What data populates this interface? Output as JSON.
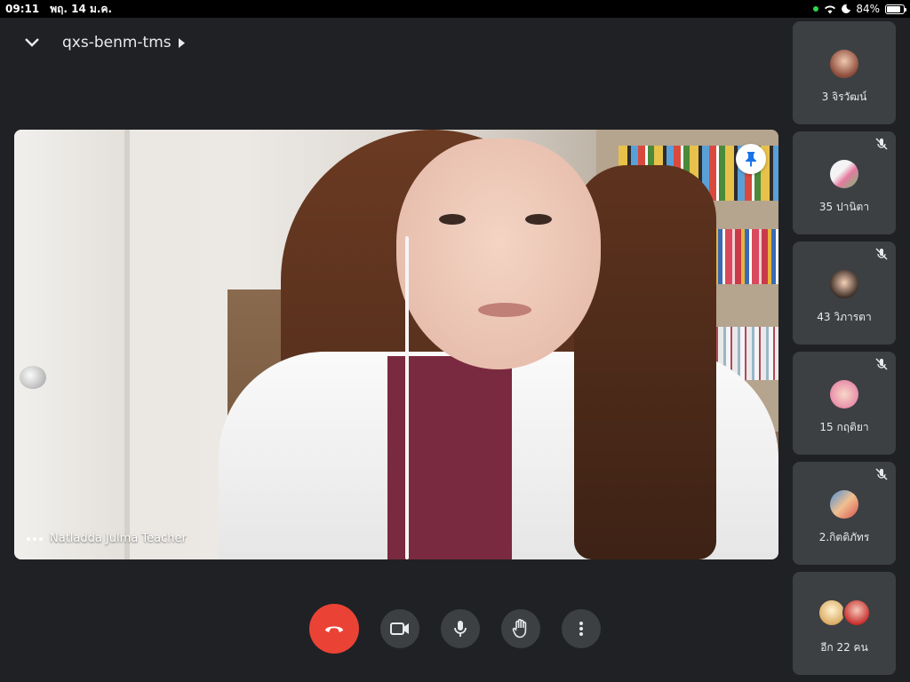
{
  "status_bar": {
    "time": "09:11",
    "date": "พฤ. 14 ม.ค.",
    "battery": "84%",
    "battery_level": 0.84
  },
  "meeting": {
    "code": "qxs-benm-tms"
  },
  "main_video": {
    "speaker_name": "Natladda Julma Teacher"
  },
  "participants": [
    {
      "name": "3 จิรวัฒน์",
      "muted": false
    },
    {
      "name": "35 ปานิตา",
      "muted": true
    },
    {
      "name": "43 วิภารตา",
      "muted": true
    },
    {
      "name": "15 กฤติยา",
      "muted": true
    },
    {
      "name": "2.กิตติภัทร",
      "muted": true
    },
    {
      "name": "อีก 22 คน",
      "muted": false
    }
  ],
  "colors": {
    "background": "#202124",
    "tile": "#3c4043",
    "end_call": "#ea4335"
  }
}
